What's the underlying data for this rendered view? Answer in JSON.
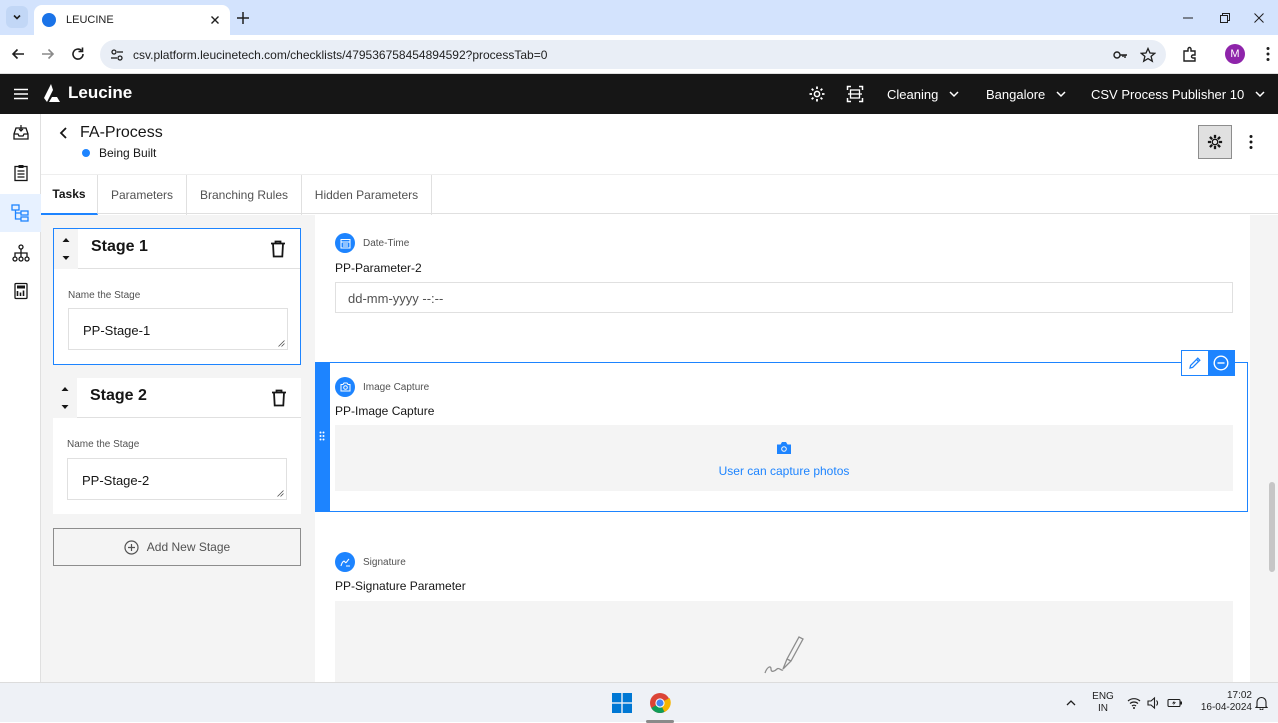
{
  "browser": {
    "tab_title": "LEUCINE",
    "url": "csv.platform.leucinetech.com/checklists/479536758454894592?processTab=0",
    "profile_initial": "M"
  },
  "app": {
    "brand": "Leucine",
    "facility": "Cleaning",
    "location": "Bangalore",
    "user": "CSV Process Publisher 10"
  },
  "page": {
    "title": "FA-Process",
    "status": "Being Built",
    "status_color": "#1d84ff",
    "tabs": [
      {
        "label": "Tasks",
        "active": true
      },
      {
        "label": "Parameters"
      },
      {
        "label": "Branching Rules"
      },
      {
        "label": "Hidden Parameters"
      }
    ]
  },
  "stages": [
    {
      "title": "Stage 1",
      "field_label": "Name the Stage",
      "value": "PP-Stage-1",
      "active": true
    },
    {
      "title": "Stage 2",
      "field_label": "Name the Stage",
      "value": "PP-Stage-2"
    }
  ],
  "add_stage_label": "Add New Stage",
  "parameters": [
    {
      "type": "Date-Time",
      "name": "PP-Parameter-2",
      "placeholder": "dd-mm-yyyy --:--",
      "icon": "calendar-icon"
    },
    {
      "type": "Image Capture",
      "name": "PP-Image Capture",
      "hint": "User can capture photos",
      "icon": "camera-icon"
    },
    {
      "type": "Signature",
      "name": "PP-Signature Parameter",
      "icon": "signature-icon"
    }
  ],
  "taskbar": {
    "lang_top": "ENG",
    "lang_bottom": "IN",
    "time": "17:02",
    "date": "16-04-2024"
  }
}
